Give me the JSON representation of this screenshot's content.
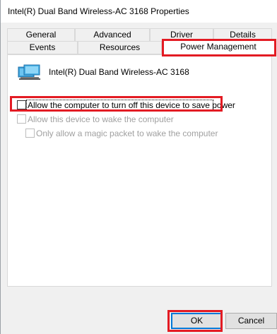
{
  "window": {
    "title": "Intel(R) Dual Band Wireless-AC 3168 Properties"
  },
  "tabs": {
    "back_row": [
      "General",
      "Advanced",
      "Driver",
      "Details"
    ],
    "front_row": [
      "Events",
      "Resources",
      "Power Management"
    ],
    "active": "Power Management"
  },
  "device": {
    "icon": "network-adapter-icon",
    "name": "Intel(R) Dual Band Wireless-AC 3168"
  },
  "options": {
    "allow_turn_off": {
      "label": "Allow the computer to turn off this device to save power",
      "checked": false,
      "enabled": true
    },
    "allow_wake": {
      "label": "Allow this device to wake the computer",
      "checked": false,
      "enabled": false
    },
    "magic_packet": {
      "label": "Only allow a magic packet to wake the computer",
      "checked": false,
      "enabled": false
    }
  },
  "buttons": {
    "ok": "OK",
    "cancel": "Cancel"
  },
  "colors": {
    "highlight_box": "#e31b23",
    "default_button_border": "#0078d7"
  }
}
